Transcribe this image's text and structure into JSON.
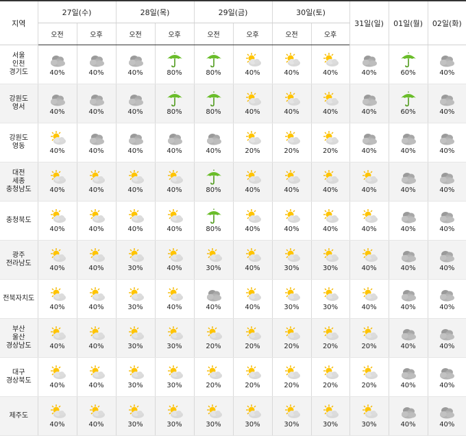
{
  "header": {
    "region_label": "지역",
    "am": "오전",
    "pm": "오후",
    "split_days": [
      "27일(수)",
      "28일(목)",
      "29일(금)",
      "30일(토)"
    ],
    "full_days": [
      "31일(일)",
      "01일(월)",
      "02일(화)"
    ]
  },
  "icon_legend": {
    "cloudy": "cloudy-icon",
    "partly": "sun-behind-cloud-icon",
    "rain": "green-umbrella-icon"
  },
  "rows": [
    {
      "region": [
        "서울",
        "인천",
        "경기도"
      ],
      "cells": [
        {
          "icon": "cloudy",
          "pct": "40%"
        },
        {
          "icon": "cloudy",
          "pct": "40%"
        },
        {
          "icon": "cloudy",
          "pct": "40%"
        },
        {
          "icon": "rain",
          "pct": "80%"
        },
        {
          "icon": "rain",
          "pct": "80%"
        },
        {
          "icon": "partly",
          "pct": "40%"
        },
        {
          "icon": "partly",
          "pct": "40%"
        },
        {
          "icon": "partly",
          "pct": "40%"
        },
        {
          "icon": "cloudy",
          "pct": "40%"
        },
        {
          "icon": "rain",
          "pct": "60%"
        },
        {
          "icon": "cloudy",
          "pct": "40%"
        }
      ]
    },
    {
      "region": [
        "강원도",
        "영서"
      ],
      "cells": [
        {
          "icon": "cloudy",
          "pct": "40%"
        },
        {
          "icon": "cloudy",
          "pct": "40%"
        },
        {
          "icon": "cloudy",
          "pct": "40%"
        },
        {
          "icon": "rain",
          "pct": "80%"
        },
        {
          "icon": "rain",
          "pct": "80%"
        },
        {
          "icon": "partly",
          "pct": "40%"
        },
        {
          "icon": "partly",
          "pct": "40%"
        },
        {
          "icon": "partly",
          "pct": "40%"
        },
        {
          "icon": "cloudy",
          "pct": "40%"
        },
        {
          "icon": "rain",
          "pct": "60%"
        },
        {
          "icon": "cloudy",
          "pct": "40%"
        }
      ]
    },
    {
      "region": [
        "강원도",
        "영동"
      ],
      "cells": [
        {
          "icon": "partly",
          "pct": "40%"
        },
        {
          "icon": "cloudy",
          "pct": "40%"
        },
        {
          "icon": "cloudy",
          "pct": "40%"
        },
        {
          "icon": "cloudy",
          "pct": "40%"
        },
        {
          "icon": "cloudy",
          "pct": "40%"
        },
        {
          "icon": "partly",
          "pct": "20%"
        },
        {
          "icon": "partly",
          "pct": "20%"
        },
        {
          "icon": "partly",
          "pct": "20%"
        },
        {
          "icon": "cloudy",
          "pct": "40%"
        },
        {
          "icon": "cloudy",
          "pct": "40%"
        },
        {
          "icon": "cloudy",
          "pct": "40%"
        }
      ]
    },
    {
      "region": [
        "대전",
        "세종",
        "충청남도"
      ],
      "cells": [
        {
          "icon": "partly",
          "pct": "40%"
        },
        {
          "icon": "partly",
          "pct": "40%"
        },
        {
          "icon": "partly",
          "pct": "40%"
        },
        {
          "icon": "partly",
          "pct": "40%"
        },
        {
          "icon": "rain",
          "pct": "80%"
        },
        {
          "icon": "partly",
          "pct": "40%"
        },
        {
          "icon": "partly",
          "pct": "40%"
        },
        {
          "icon": "partly",
          "pct": "40%"
        },
        {
          "icon": "partly",
          "pct": "40%"
        },
        {
          "icon": "cloudy",
          "pct": "40%"
        },
        {
          "icon": "cloudy",
          "pct": "40%"
        }
      ]
    },
    {
      "region": [
        "충청북도"
      ],
      "cells": [
        {
          "icon": "partly",
          "pct": "40%"
        },
        {
          "icon": "partly",
          "pct": "40%"
        },
        {
          "icon": "partly",
          "pct": "40%"
        },
        {
          "icon": "partly",
          "pct": "40%"
        },
        {
          "icon": "rain",
          "pct": "80%"
        },
        {
          "icon": "partly",
          "pct": "40%"
        },
        {
          "icon": "partly",
          "pct": "40%"
        },
        {
          "icon": "partly",
          "pct": "40%"
        },
        {
          "icon": "partly",
          "pct": "40%"
        },
        {
          "icon": "cloudy",
          "pct": "40%"
        },
        {
          "icon": "cloudy",
          "pct": "40%"
        }
      ]
    },
    {
      "region": [
        "광주",
        "전라남도"
      ],
      "cells": [
        {
          "icon": "partly",
          "pct": "40%"
        },
        {
          "icon": "partly",
          "pct": "40%"
        },
        {
          "icon": "partly",
          "pct": "30%"
        },
        {
          "icon": "partly",
          "pct": "40%"
        },
        {
          "icon": "partly",
          "pct": "30%"
        },
        {
          "icon": "partly",
          "pct": "40%"
        },
        {
          "icon": "partly",
          "pct": "30%"
        },
        {
          "icon": "partly",
          "pct": "30%"
        },
        {
          "icon": "partly",
          "pct": "40%"
        },
        {
          "icon": "cloudy",
          "pct": "40%"
        },
        {
          "icon": "cloudy",
          "pct": "40%"
        }
      ]
    },
    {
      "region": [
        "전북자치도"
      ],
      "cells": [
        {
          "icon": "partly",
          "pct": "40%"
        },
        {
          "icon": "partly",
          "pct": "40%"
        },
        {
          "icon": "partly",
          "pct": "30%"
        },
        {
          "icon": "partly",
          "pct": "40%"
        },
        {
          "icon": "cloudy",
          "pct": "40%"
        },
        {
          "icon": "partly",
          "pct": "40%"
        },
        {
          "icon": "partly",
          "pct": "30%"
        },
        {
          "icon": "partly",
          "pct": "30%"
        },
        {
          "icon": "partly",
          "pct": "40%"
        },
        {
          "icon": "cloudy",
          "pct": "40%"
        },
        {
          "icon": "cloudy",
          "pct": "40%"
        }
      ]
    },
    {
      "region": [
        "부산",
        "울산",
        "경상남도"
      ],
      "cells": [
        {
          "icon": "partly",
          "pct": "40%"
        },
        {
          "icon": "partly",
          "pct": "40%"
        },
        {
          "icon": "partly",
          "pct": "30%"
        },
        {
          "icon": "partly",
          "pct": "30%"
        },
        {
          "icon": "partly",
          "pct": "20%"
        },
        {
          "icon": "partly",
          "pct": "20%"
        },
        {
          "icon": "partly",
          "pct": "20%"
        },
        {
          "icon": "partly",
          "pct": "20%"
        },
        {
          "icon": "partly",
          "pct": "20%"
        },
        {
          "icon": "cloudy",
          "pct": "40%"
        },
        {
          "icon": "cloudy",
          "pct": "40%"
        }
      ]
    },
    {
      "region": [
        "대구",
        "경상북도"
      ],
      "cells": [
        {
          "icon": "partly",
          "pct": "40%"
        },
        {
          "icon": "partly",
          "pct": "40%"
        },
        {
          "icon": "partly",
          "pct": "30%"
        },
        {
          "icon": "partly",
          "pct": "30%"
        },
        {
          "icon": "partly",
          "pct": "20%"
        },
        {
          "icon": "partly",
          "pct": "20%"
        },
        {
          "icon": "partly",
          "pct": "20%"
        },
        {
          "icon": "partly",
          "pct": "20%"
        },
        {
          "icon": "partly",
          "pct": "20%"
        },
        {
          "icon": "cloudy",
          "pct": "40%"
        },
        {
          "icon": "cloudy",
          "pct": "40%"
        }
      ]
    },
    {
      "region": [
        "제주도"
      ],
      "cells": [
        {
          "icon": "partly",
          "pct": "40%"
        },
        {
          "icon": "partly",
          "pct": "40%"
        },
        {
          "icon": "partly",
          "pct": "30%"
        },
        {
          "icon": "partly",
          "pct": "30%"
        },
        {
          "icon": "partly",
          "pct": "30%"
        },
        {
          "icon": "partly",
          "pct": "30%"
        },
        {
          "icon": "partly",
          "pct": "30%"
        },
        {
          "icon": "partly",
          "pct": "30%"
        },
        {
          "icon": "partly",
          "pct": "30%"
        },
        {
          "icon": "cloudy",
          "pct": "40%"
        },
        {
          "icon": "cloudy",
          "pct": "40%"
        }
      ]
    }
  ]
}
